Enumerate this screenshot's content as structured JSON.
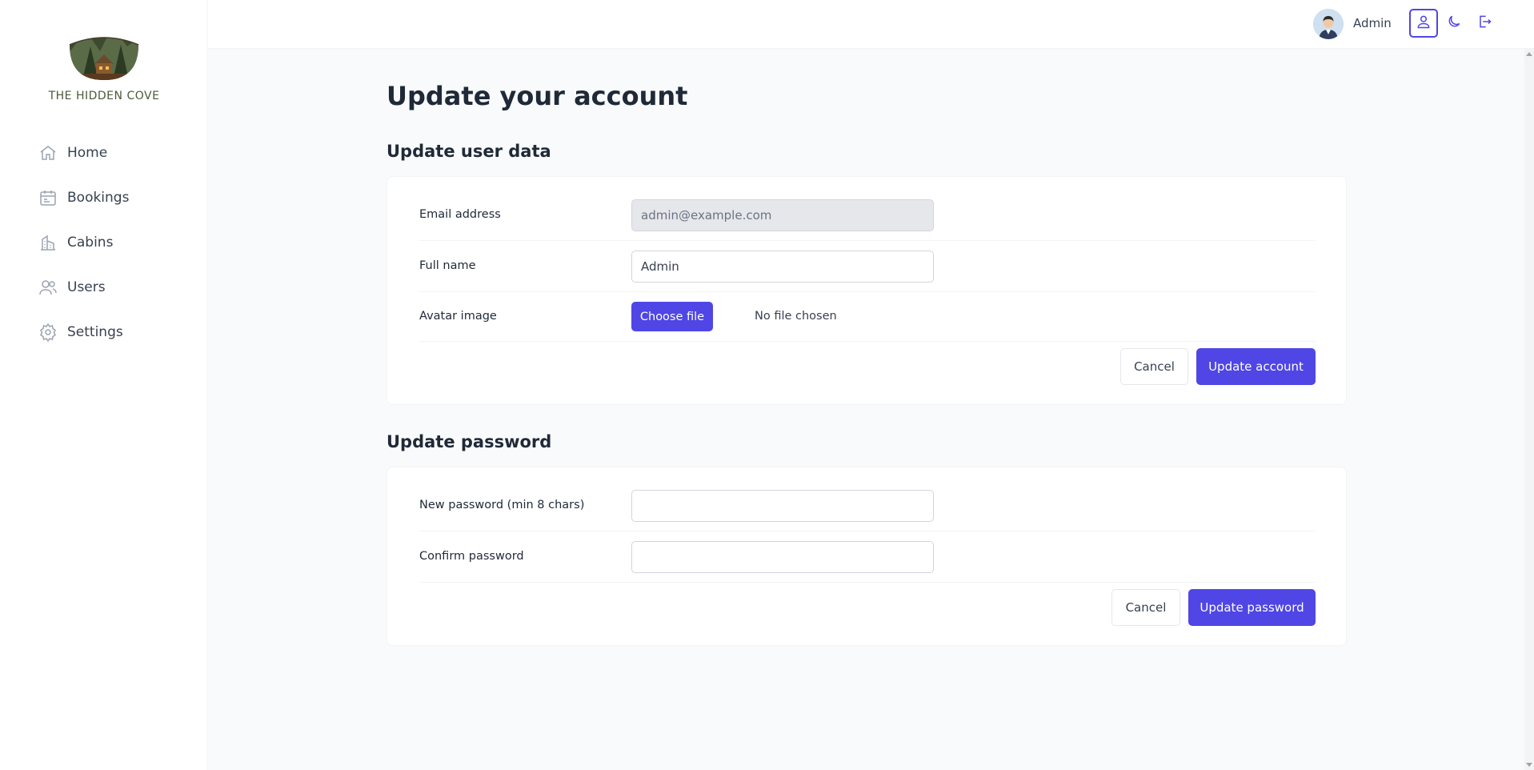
{
  "app": {
    "brand": "THE HIDDEN COVE"
  },
  "sidebar": {
    "items": [
      {
        "label": "Home",
        "icon": "home-icon"
      },
      {
        "label": "Bookings",
        "icon": "calendar-icon"
      },
      {
        "label": "Cabins",
        "icon": "building-icon"
      },
      {
        "label": "Users",
        "icon": "users-icon"
      },
      {
        "label": "Settings",
        "icon": "gear-icon"
      }
    ]
  },
  "header": {
    "user_name": "Admin",
    "buttons": [
      "user-icon",
      "moon-icon",
      "logout-icon"
    ]
  },
  "main": {
    "title": "Update your account",
    "user_section": {
      "title": "Update user data",
      "email_label": "Email address",
      "email_value": "admin@example.com",
      "fullname_label": "Full name",
      "fullname_value": "Admin",
      "avatar_label": "Avatar image",
      "file_button": "Choose file",
      "file_status": "No file chosen",
      "cancel": "Cancel",
      "submit": "Update account"
    },
    "password_section": {
      "title": "Update password",
      "new_label": "New password (min 8 chars)",
      "new_value": "",
      "confirm_label": "Confirm password",
      "confirm_value": "",
      "cancel": "Cancel",
      "submit": "Update password"
    }
  },
  "colors": {
    "accent": "#4f46e5",
    "background": "#f9fafb",
    "surface": "#ffffff",
    "text": "#374151"
  }
}
